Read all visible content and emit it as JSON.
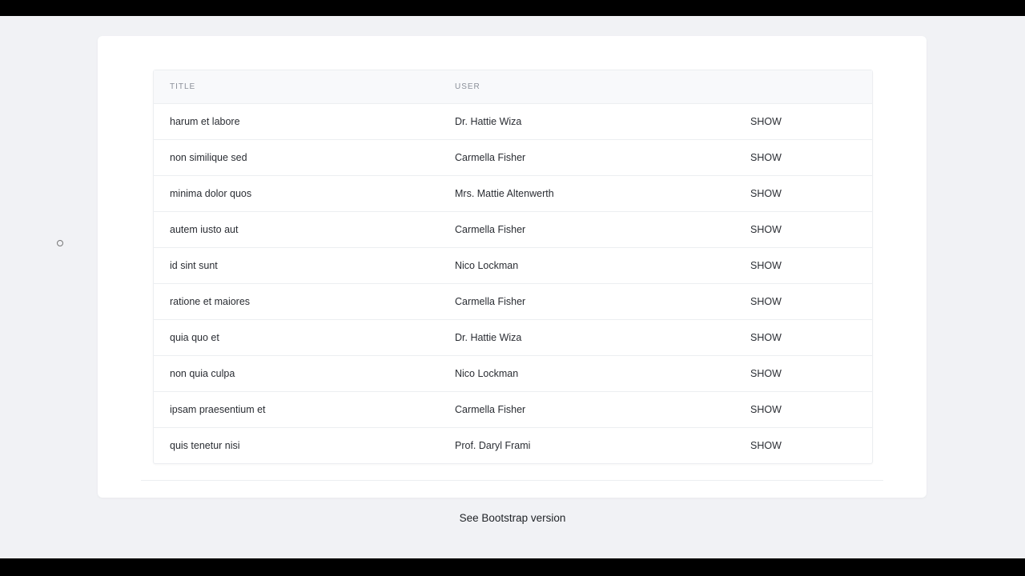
{
  "table": {
    "headers": [
      "TITLE",
      "USER",
      ""
    ],
    "rows": [
      {
        "title": "harum et labore",
        "user": "Dr. Hattie Wiza",
        "action": "SHOW"
      },
      {
        "title": "non similique sed",
        "user": "Carmella Fisher",
        "action": "SHOW"
      },
      {
        "title": "minima dolor quos",
        "user": "Mrs. Mattie Altenwerth",
        "action": "SHOW"
      },
      {
        "title": "autem iusto aut",
        "user": "Carmella Fisher",
        "action": "SHOW"
      },
      {
        "title": "id sint sunt",
        "user": "Nico Lockman",
        "action": "SHOW"
      },
      {
        "title": "ratione et maiores",
        "user": "Carmella Fisher",
        "action": "SHOW"
      },
      {
        "title": "quia quo et",
        "user": "Dr. Hattie Wiza",
        "action": "SHOW"
      },
      {
        "title": "non quia culpa",
        "user": "Nico Lockman",
        "action": "SHOW"
      },
      {
        "title": "ipsam praesentium et",
        "user": "Carmella Fisher",
        "action": "SHOW"
      },
      {
        "title": "quis tenetur nisi",
        "user": "Prof. Daryl Frami",
        "action": "SHOW"
      }
    ]
  },
  "footer": {
    "link_label": "See Bootstrap version"
  },
  "colors": {
    "page_background": "#f1f2f5",
    "card_background": "#ffffff",
    "header_background": "#f8f9fb",
    "border": "#eceef1"
  }
}
